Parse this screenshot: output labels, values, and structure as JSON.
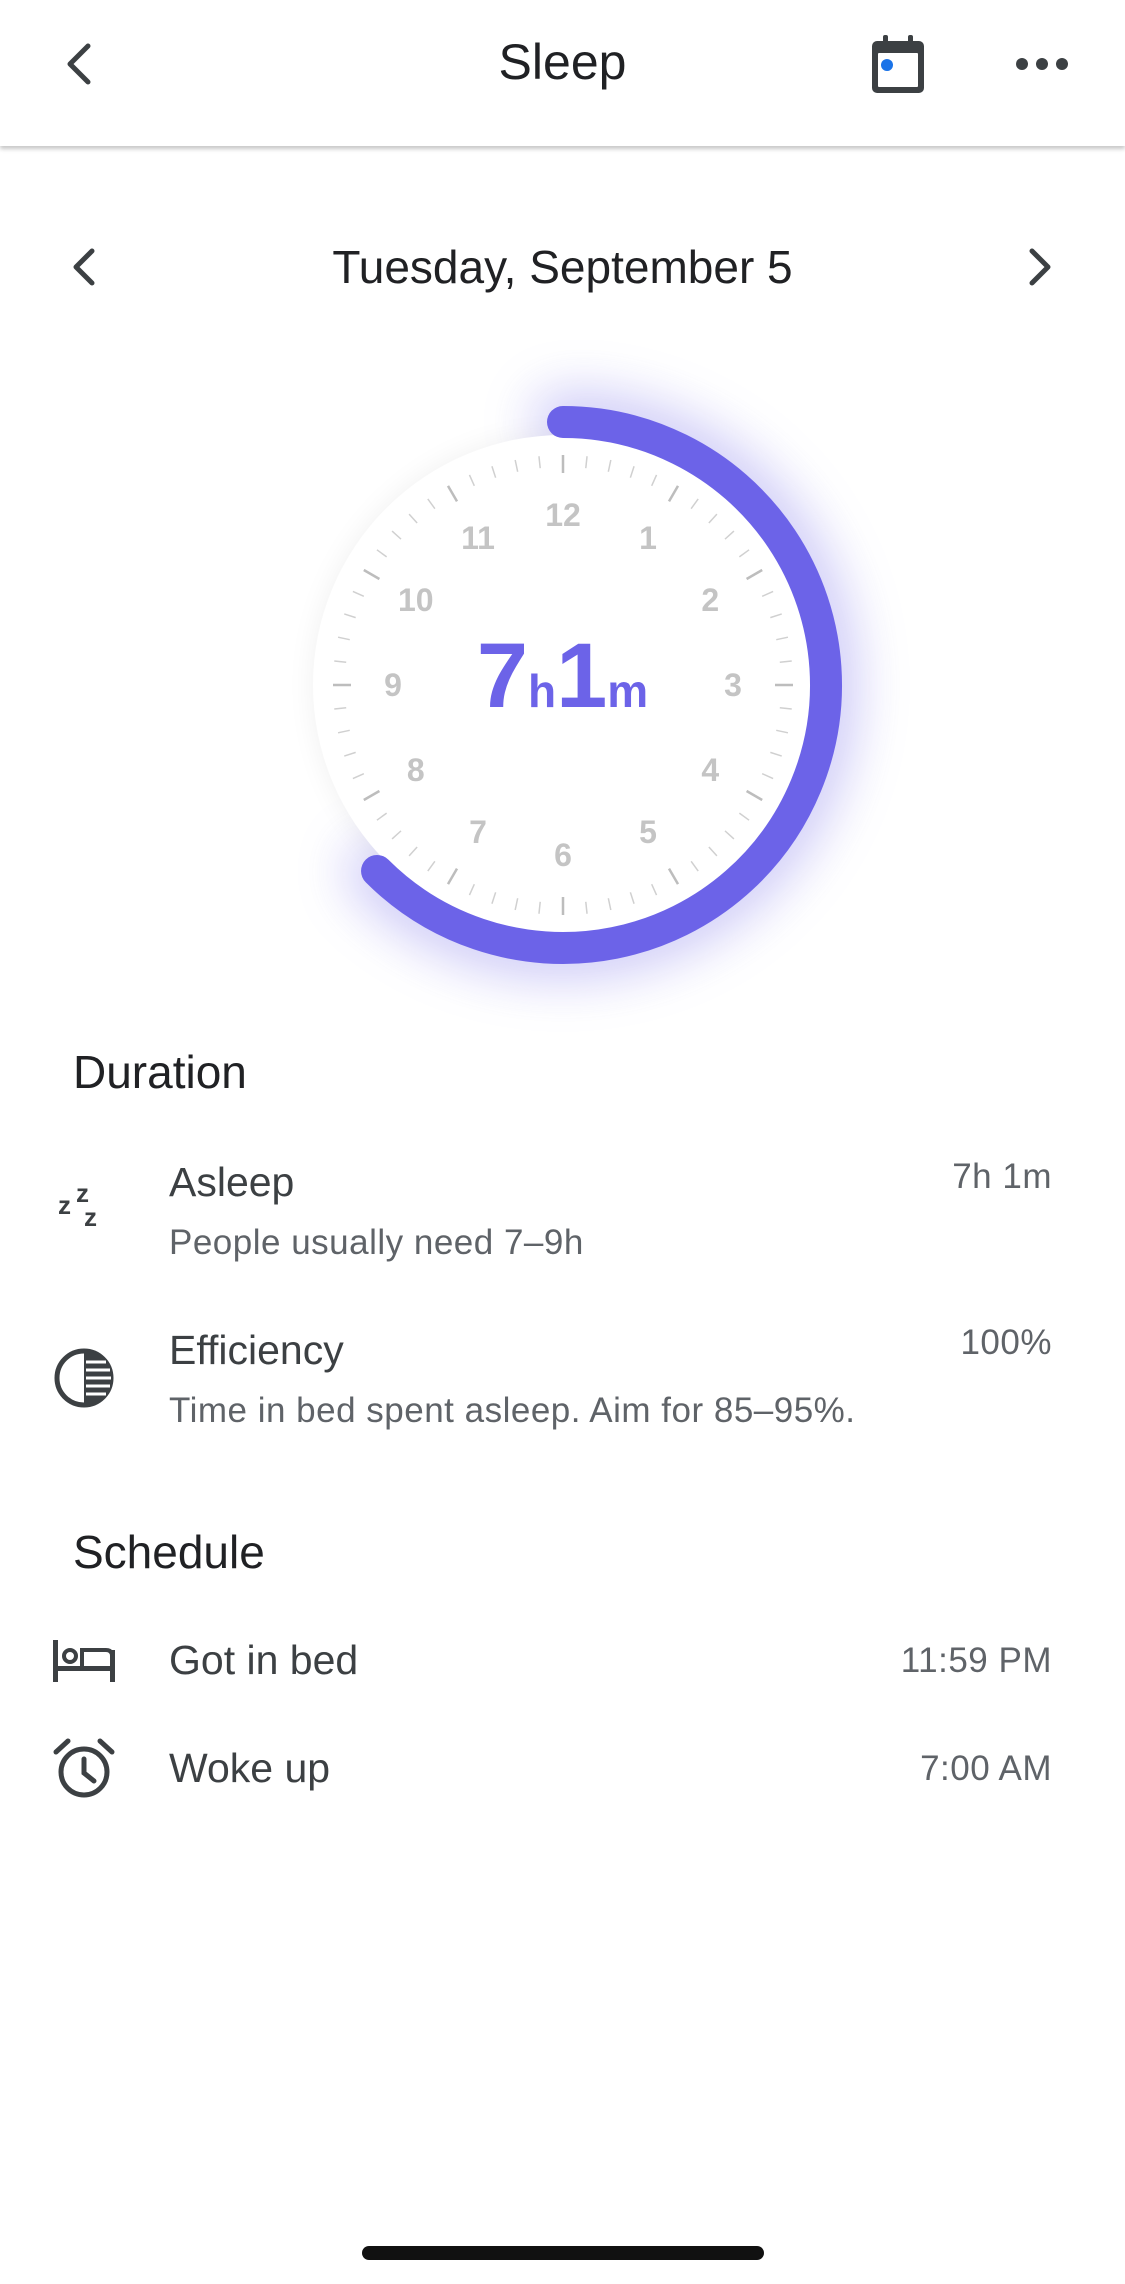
{
  "header": {
    "title": "Sleep",
    "back_icon": "chevron-left-icon",
    "calendar_icon": "calendar-icon",
    "more_icon": "more-horizontal-icon"
  },
  "date_nav": {
    "date": "Tuesday, September 5",
    "prev_icon": "chevron-left-icon",
    "next_icon": "chevron-right-icon"
  },
  "dial": {
    "hours_value": "7",
    "hours_unit": "h",
    "minutes_value": "1",
    "minutes_unit": "m",
    "clock_numbers": [
      "12",
      "1",
      "2",
      "3",
      "4",
      "5",
      "6",
      "7",
      "8",
      "9",
      "10",
      "11"
    ],
    "arc_color": "#6c63e8",
    "sleep_start_hour": 0,
    "sleep_end_hour": 7.5
  },
  "duration": {
    "title": "Duration",
    "items": [
      {
        "icon": "zzz-icon",
        "label": "Asleep",
        "subtitle": "People usually need 7–9h",
        "value": "7h 1m"
      },
      {
        "icon": "efficiency-icon",
        "label": "Efficiency",
        "subtitle": "Time in bed spent asleep. Aim for 85–95%.",
        "value": "100%"
      }
    ]
  },
  "schedule": {
    "title": "Schedule",
    "items": [
      {
        "icon": "bed-icon",
        "label": "Got in bed",
        "value": "11:59 PM"
      },
      {
        "icon": "alarm-clock-icon",
        "label": "Woke up",
        "value": "7:00 AM"
      }
    ]
  },
  "colors": {
    "accent": "#6c63e8",
    "calendar_dot": "#1a73e8",
    "text_primary": "#202124",
    "text_secondary": "#5f6368"
  }
}
